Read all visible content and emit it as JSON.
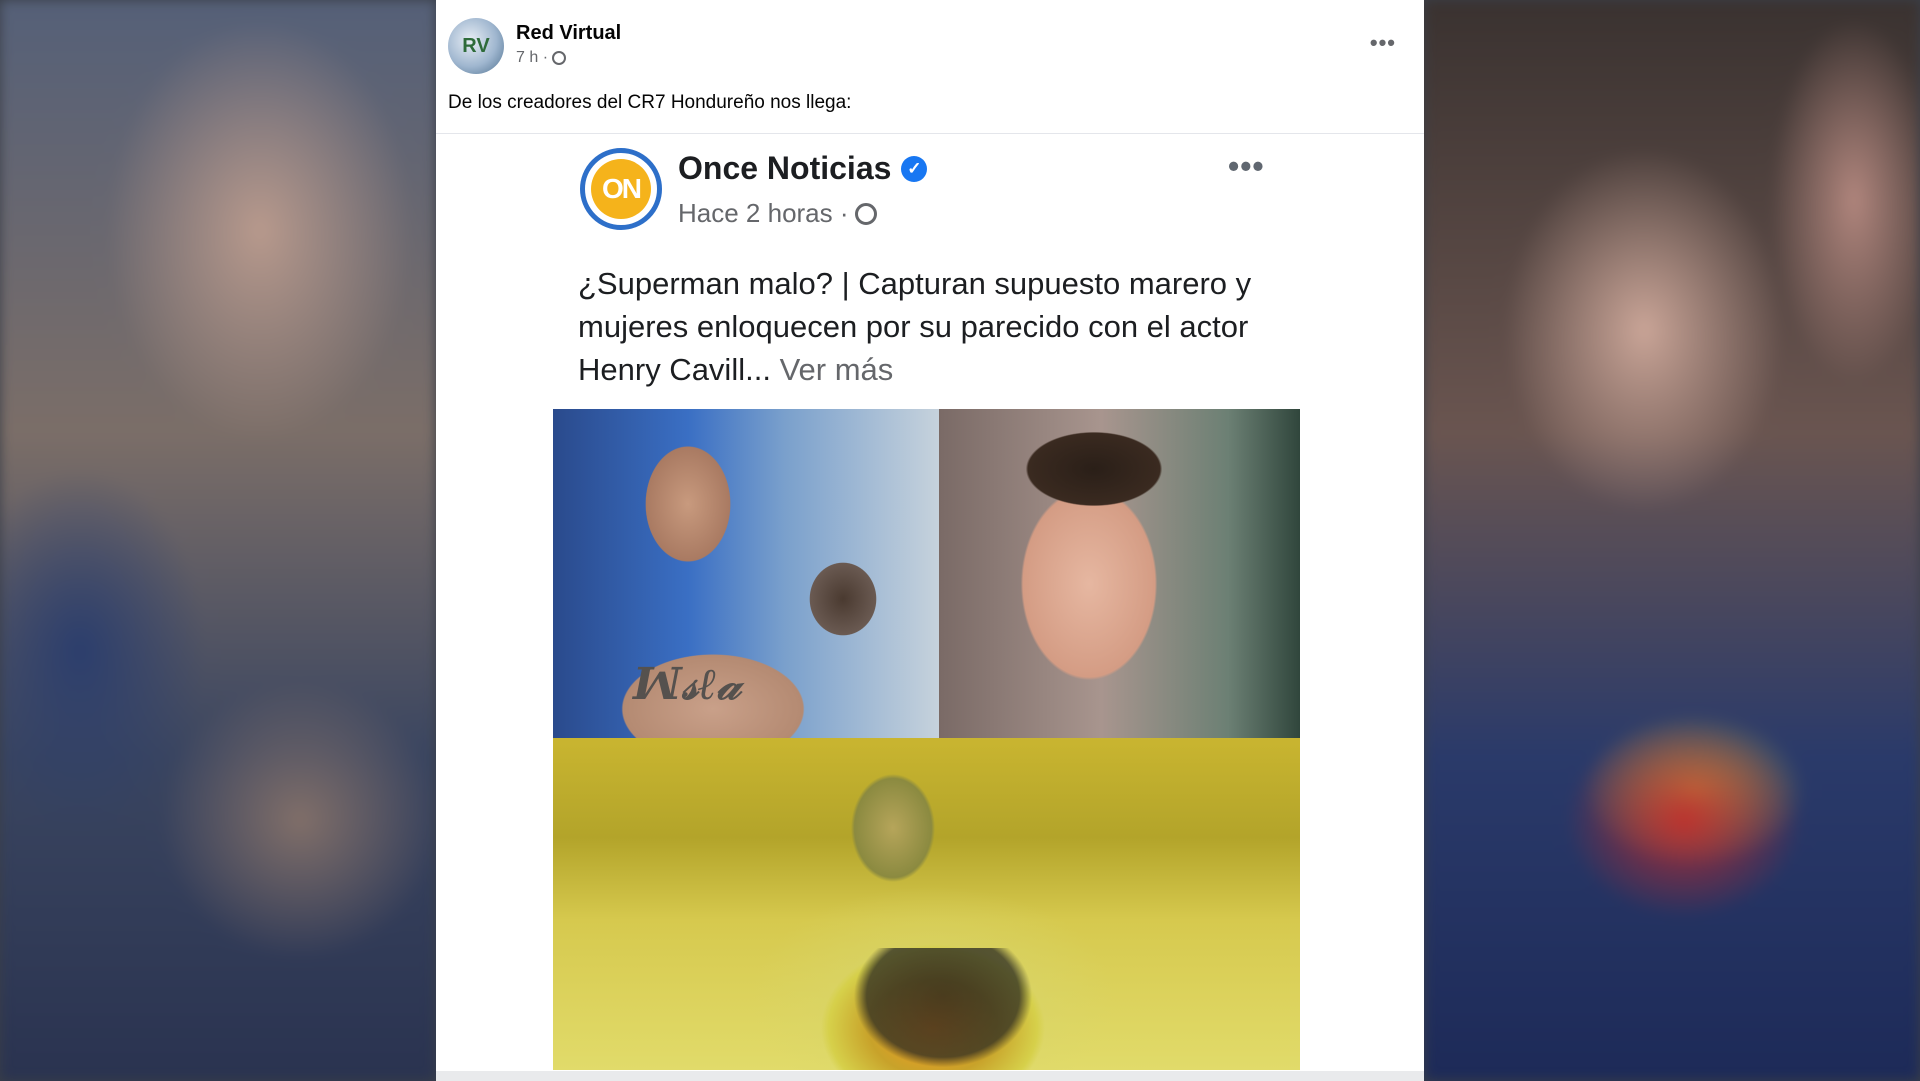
{
  "post": {
    "author": "Red Virtual",
    "time": "7 h ·",
    "caption": "De los creadores del CR7 Hondureño nos llega:",
    "more_icon": "ellipsis-horizontal-icon",
    "privacy_icon": "globe-icon"
  },
  "embedded_post": {
    "logo_text": "ON",
    "page_name": "Once Noticias",
    "verified_icon": "verified-badge-icon",
    "time": "Hace 2 horas ·",
    "privacy_icon": "globe-icon",
    "text": "¿Superman malo? | Capturan supuesto marero y mujeres enloquecen por su parecido con el actor Henry Cavill...",
    "see_more": "Ver más"
  },
  "colors": {
    "card_background": "#ffffff",
    "verified_blue": "#1877f2",
    "logo_ring": "#2d6fc9",
    "logo_fill": "#f5b31b",
    "meta_gray": "#65676b"
  }
}
